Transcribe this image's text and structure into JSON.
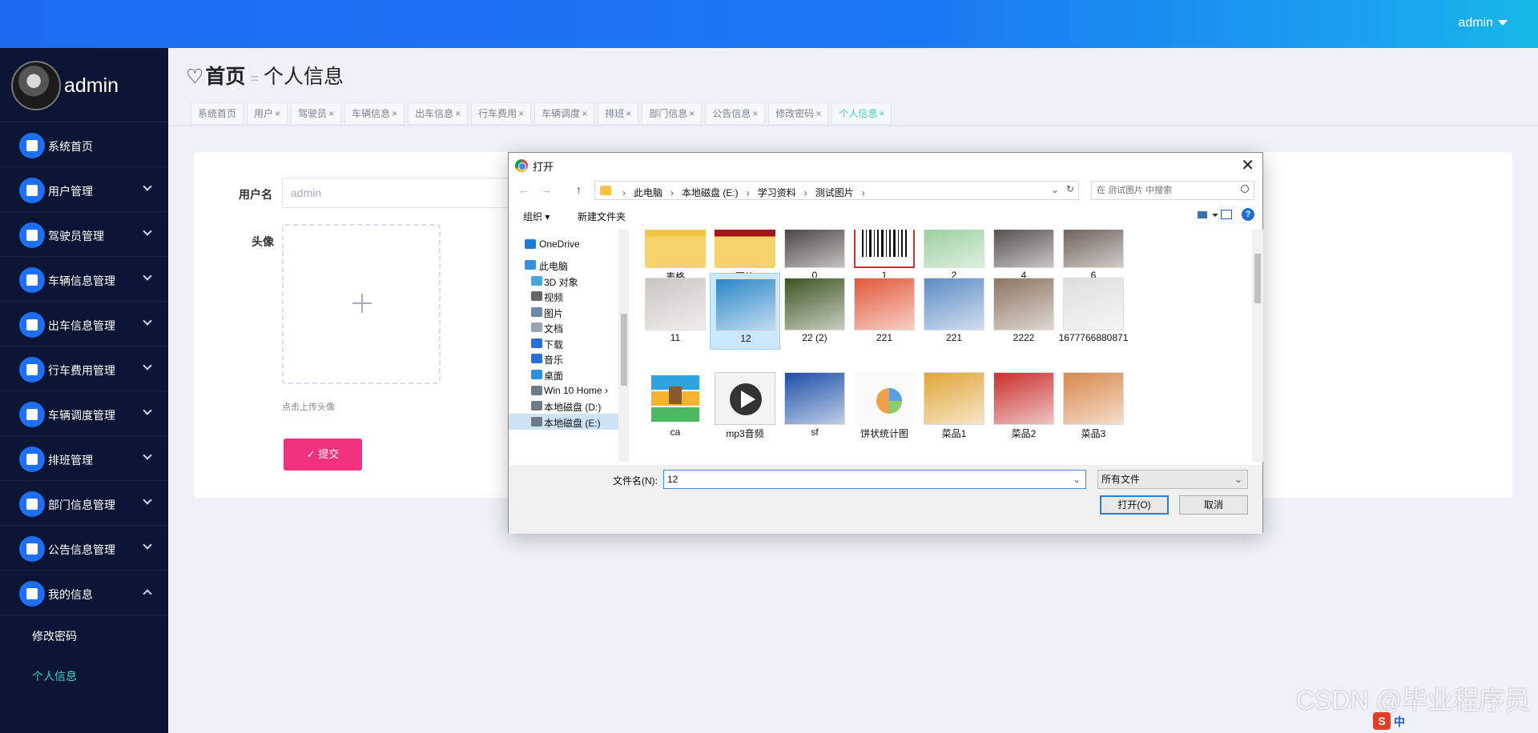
{
  "header": {
    "user": "admin"
  },
  "sidebar": {
    "profile_name": "admin",
    "items": [
      {
        "label": "系统首页",
        "icon": "home-icon",
        "expandable": false
      },
      {
        "label": "用户管理",
        "icon": "grid-icon",
        "expandable": true
      },
      {
        "label": "驾驶员管理",
        "icon": "driver-icon",
        "expandable": true
      },
      {
        "label": "车辆信息管理",
        "icon": "briefcase-icon",
        "expandable": true
      },
      {
        "label": "出车信息管理",
        "icon": "grid-icon",
        "expandable": true
      },
      {
        "label": "行车费用管理",
        "icon": "wallet-icon",
        "expandable": true
      },
      {
        "label": "车辆调度管理",
        "icon": "chat-icon",
        "expandable": true
      },
      {
        "label": "排班管理",
        "icon": "grid-icon",
        "expandable": true
      },
      {
        "label": "部门信息管理",
        "icon": "grid-icon",
        "expandable": true
      },
      {
        "label": "公告信息管理",
        "icon": "grid-icon",
        "expandable": true
      },
      {
        "label": "我的信息",
        "icon": "card-icon",
        "expandable": true,
        "expanded": true
      }
    ],
    "sub_items": [
      {
        "label": "修改密码",
        "active": false
      },
      {
        "label": "个人信息",
        "active": true
      }
    ]
  },
  "breadcrumb": {
    "home": "首页",
    "current": "个人信息"
  },
  "tabs": [
    {
      "label": "系统首页",
      "closable": false,
      "active": false
    },
    {
      "label": "用户",
      "closable": true,
      "active": false
    },
    {
      "label": "驾驶员",
      "closable": true,
      "active": false
    },
    {
      "label": "车辆信息",
      "closable": true,
      "active": false
    },
    {
      "label": "出车信息",
      "closable": true,
      "active": false
    },
    {
      "label": "行车费用",
      "closable": true,
      "active": false
    },
    {
      "label": "车辆调度",
      "closable": true,
      "active": false
    },
    {
      "label": "排班",
      "closable": true,
      "active": false
    },
    {
      "label": "部门信息",
      "closable": true,
      "active": false
    },
    {
      "label": "公告信息",
      "closable": true,
      "active": false
    },
    {
      "label": "修改密码",
      "closable": true,
      "active": false
    },
    {
      "label": "个人信息",
      "closable": true,
      "active": true
    }
  ],
  "form": {
    "username_label": "用户名",
    "username_value": "admin",
    "avatar_label": "头像",
    "upload_tip": "点击上传头像",
    "submit_label": "提交"
  },
  "dialog": {
    "title": "打开",
    "path": [
      "此电脑",
      "本地磁盘 (E:)",
      "学习资料",
      "测试图片"
    ],
    "search_placeholder": "在 测试图片 中搜索",
    "organize": "组织 ▾",
    "new_folder": "新建文件夹",
    "nav_items": [
      {
        "label": "OneDrive",
        "icon": "cloud-icon",
        "color": "#1f7ad8",
        "indent": 1,
        "selected": false
      },
      {
        "label": "此电脑",
        "icon": "computer-icon",
        "color": "#3c8dde",
        "indent": 1,
        "selected": false
      },
      {
        "label": "3D 对象",
        "icon": "cube-icon",
        "color": "#49a8d9",
        "indent": 2,
        "selected": false
      },
      {
        "label": "视频",
        "icon": "video-icon",
        "color": "#666666",
        "indent": 2,
        "selected": false
      },
      {
        "label": "图片",
        "icon": "picture-icon",
        "color": "#6a88a8",
        "indent": 2,
        "selected": false
      },
      {
        "label": "文档",
        "icon": "document-icon",
        "color": "#9aa4b0",
        "indent": 2,
        "selected": false
      },
      {
        "label": "下载",
        "icon": "download-icon",
        "color": "#2a6fd6",
        "indent": 2,
        "selected": false
      },
      {
        "label": "音乐",
        "icon": "music-icon",
        "color": "#2a6fd6",
        "indent": 2,
        "selected": false
      },
      {
        "label": "桌面",
        "icon": "desktop-icon",
        "color": "#2a8fe0",
        "indent": 2,
        "selected": false
      },
      {
        "label": "Win 10 Home ›",
        "icon": "drive-icon",
        "color": "#6d7a88",
        "indent": 2,
        "selected": false
      },
      {
        "label": "本地磁盘 (D:)",
        "icon": "drive-icon",
        "color": "#6d7a88",
        "indent": 2,
        "selected": false
      },
      {
        "label": "本地磁盘 (E:)",
        "icon": "drive-icon",
        "color": "#6d7a88",
        "indent": 2,
        "selected": true
      }
    ],
    "files": [
      {
        "name": "表格",
        "kind": "folder-icon",
        "color": "#f4c542",
        "selected": false
      },
      {
        "name": "图片",
        "kind": "folder-icon",
        "color": "#a3151b",
        "selected": false
      },
      {
        "name": "0",
        "kind": "photo-icon",
        "color": "#2f2a28",
        "selected": false
      },
      {
        "name": "1",
        "kind": "barcode-icon",
        "color": "#c73232",
        "selected": false
      },
      {
        "name": "2",
        "kind": "photo-icon",
        "color": "#8cc98e",
        "selected": false
      },
      {
        "name": "4",
        "kind": "photo-icon",
        "color": "#3d3634",
        "selected": false
      },
      {
        "name": "6",
        "kind": "photo-icon",
        "color": "#5a4a42",
        "selected": false
      },
      {
        "name": "11",
        "kind": "photo-icon",
        "color": "#c9c6c0",
        "selected": false
      },
      {
        "name": "12",
        "kind": "photo-icon",
        "color": "#2c86c8",
        "selected": true
      },
      {
        "name": "22 (2)",
        "kind": "photo-icon",
        "color": "#3c5422",
        "selected": false
      },
      {
        "name": "221",
        "kind": "photo-icon",
        "color": "#e2583a",
        "selected": false
      },
      {
        "name": "221",
        "kind": "photo-icon",
        "color": "#5c8cc4",
        "selected": false
      },
      {
        "name": "2222",
        "kind": "photo-icon",
        "color": "#8c7460",
        "selected": false
      },
      {
        "name": "1677766880871",
        "kind": "photo-icon",
        "color": "#dedede",
        "selected": false
      },
      {
        "name": "ca",
        "kind": "archive-icon",
        "color": "#2fa2e0",
        "selected": false
      },
      {
        "name": "mp3音频",
        "kind": "play-icon",
        "color": "#333333",
        "selected": false
      },
      {
        "name": "sf",
        "kind": "photo-icon",
        "color": "#1c4fa8",
        "selected": false
      },
      {
        "name": "饼状统计图",
        "kind": "pie-icon",
        "color": "#f0a04a",
        "selected": false
      },
      {
        "name": "菜品1",
        "kind": "photo-icon",
        "color": "#e0a63a",
        "selected": false
      },
      {
        "name": "菜品2",
        "kind": "photo-icon",
        "color": "#c8302c",
        "selected": false
      },
      {
        "name": "菜品3",
        "kind": "photo-icon",
        "color": "#d9884a",
        "selected": false
      }
    ],
    "filename_label": "文件名(N):",
    "filename_value": "12",
    "filetype": "所有文件",
    "open_label": "打开(O)",
    "cancel_label": "取消"
  },
  "watermark": "CSDN @毕业程序员",
  "ime": {
    "logo": "S",
    "lang": "中"
  }
}
